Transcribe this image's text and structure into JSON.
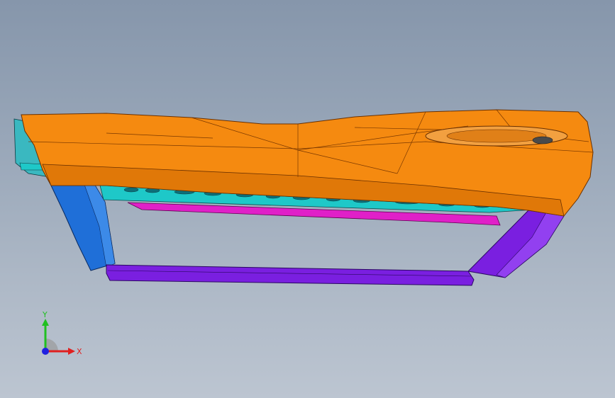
{
  "viewport": {
    "background_top": "#8696ab",
    "background_bottom": "#bcc5d1"
  },
  "model": {
    "parts": [
      {
        "name": "upper-cover",
        "color": "#f58a10"
      },
      {
        "name": "left-leg",
        "color": "#1f6fd8"
      },
      {
        "name": "right-leg",
        "color": "#7a1fe0"
      },
      {
        "name": "bottom-rail",
        "color": "#7a1fe0"
      },
      {
        "name": "inner-strip",
        "color": "#1ec8c8"
      },
      {
        "name": "magenta-strip",
        "color": "#e020c8"
      }
    ]
  },
  "triad": {
    "x_label": "X",
    "y_label": "Y",
    "x_color": "#e02020",
    "y_color": "#20c020",
    "z_color": "#2020e0"
  }
}
